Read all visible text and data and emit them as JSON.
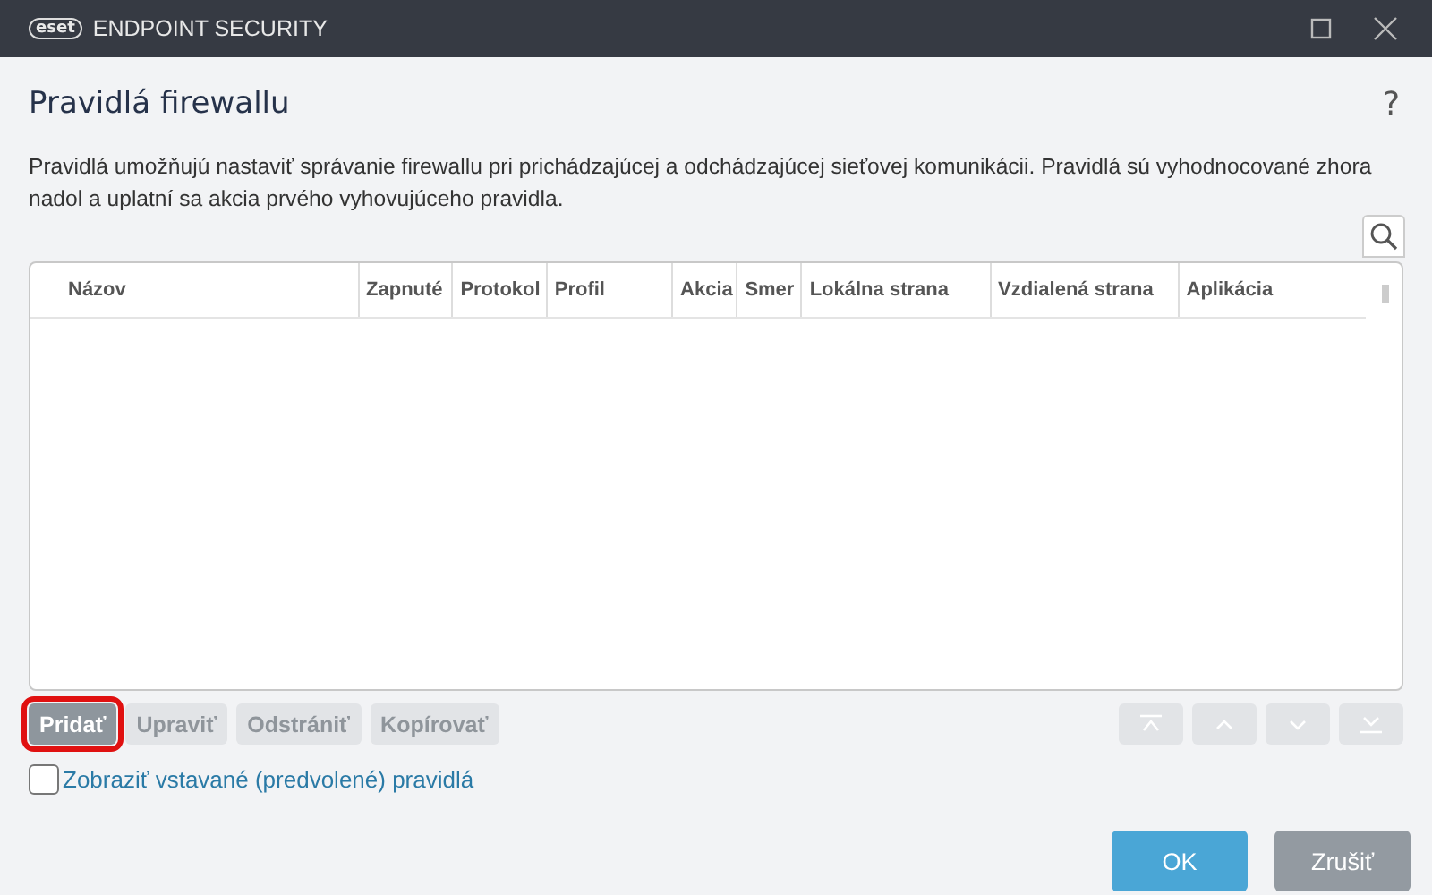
{
  "window": {
    "logo": "eset",
    "title": "ENDPOINT SECURITY"
  },
  "heading": "Pravidlá firewallu",
  "help": "?",
  "description": "Pravidlá umožňujú nastaviť správanie firewallu pri prichádzajúcej a odchádzajúcej sieťovej komunikácii. Pravidlá sú vyhodnocované zhora nadol a uplatní sa akcia prvého vyhovujúceho pravidla.",
  "table": {
    "columns": [
      {
        "label": "Názov",
        "kind": "wide"
      },
      {
        "label": "Zapnuté",
        "kind": "narrow"
      },
      {
        "label": "Protokol",
        "kind": "narrow"
      },
      {
        "label": "Profil",
        "kind": "medium"
      },
      {
        "label": "Akcia",
        "kind": "tiny"
      },
      {
        "label": "Smer",
        "kind": "tiny"
      },
      {
        "label": "Lokálna strana",
        "kind": "large"
      },
      {
        "label": "Vzdialená strana",
        "kind": "large"
      },
      {
        "label": "Aplikácia",
        "kind": "large"
      }
    ]
  },
  "actions": [
    {
      "label": "Pridať",
      "disabled": false,
      "highlighted": true
    },
    {
      "label": "Upraviť",
      "disabled": true,
      "highlighted": false
    },
    {
      "label": "Odstrániť",
      "disabled": true,
      "highlighted": false
    },
    {
      "label": "Kopírovať",
      "disabled": true,
      "highlighted": false
    }
  ],
  "move_buttons": [
    {
      "kind": "top",
      "disabled": true
    },
    {
      "kind": "up",
      "disabled": true
    },
    {
      "kind": "down",
      "disabled": true
    },
    {
      "kind": "bottom",
      "disabled": true
    }
  ],
  "show_builtin": {
    "label": "Zobraziť vstavané (predvolené) pravidlá",
    "checked": false
  },
  "footer": [
    {
      "label": "OK",
      "kind": "primary"
    },
    {
      "label": "Zrušiť",
      "kind": "secondary"
    }
  ]
}
